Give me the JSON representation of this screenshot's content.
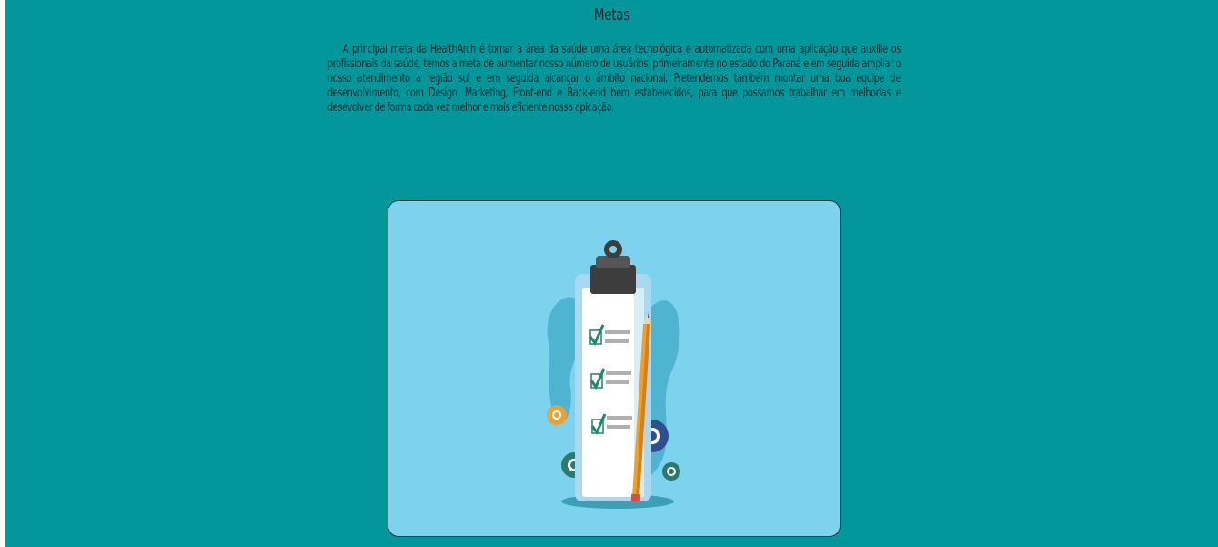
{
  "section": {
    "title": "Metas",
    "paragraph": "A principal meta da HealthArch é tornar a área da saúde uma área tecnológica e automatizada com uma aplicação que auxilie os profissionais da saúde, temos a meta de aumentar nosso número de usuários, primeiramente no estado do Paraná e em seguida ampliar o nosso atendimento a região sul e em seguida alcançar o âmbito nacional. Pretendemos também montar uma boa equipe de desenvolvimento, com Design, Marketing, Front-end e Back-end bem estabelecidos, para que possamos trabalhar em melhorias e desevolver de forma cada vez melhor e mais eficiente nossa apicação."
  },
  "illustration": {
    "icon": "clipboard-checklist-illustration",
    "background_color": "#7dd2ee",
    "page_color": "#03969b"
  }
}
